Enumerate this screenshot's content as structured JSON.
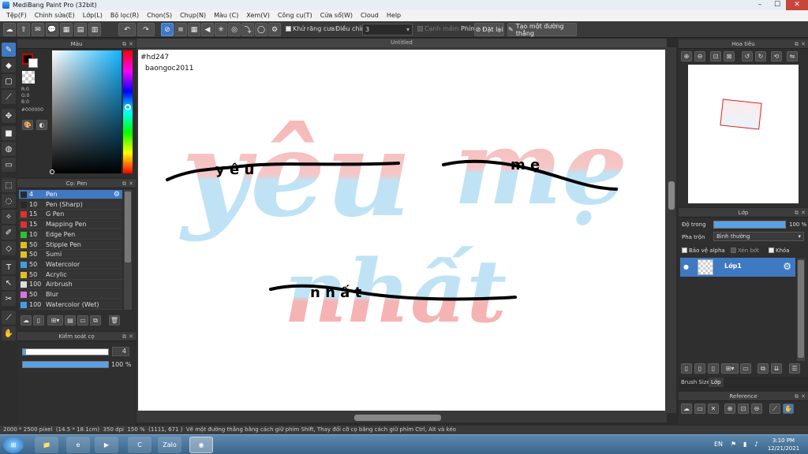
{
  "window": {
    "title": "MediBang Paint Pro (32bit)",
    "min": "–",
    "max": "☐",
    "close": "✕"
  },
  "menu": [
    "Tệp(F)",
    "Chỉnh sửa(E)",
    "Lớp(L)",
    "Bộ lọc(R)",
    "Chọn(S)",
    "Chụp(N)",
    "Màu (C)",
    "Xem(V)",
    "Công cụ(T)",
    "Cửa sổ(W)",
    "Cloud",
    "Help"
  ],
  "toolbar": {
    "antialias_label": "Khử răng cưa",
    "adjust_label": "Điều chỉnh",
    "adjust_value": "3",
    "edge_label": "Cạnh mềm",
    "pen_label": "Phím",
    "reset_label": "Đặt lại",
    "line_label": "Tạo một đường thẳng"
  },
  "color_panel": {
    "title": "Màu",
    "r": "R:0",
    "g": "G:0",
    "b": "B:0",
    "hex": "#000000",
    "fg": "#000000",
    "bg": "#ffffff"
  },
  "brush_panel": {
    "title": "Cọ: Pen",
    "items": [
      {
        "size": "4",
        "name": "Pen",
        "color": "#2a2a2a",
        "selected": true
      },
      {
        "size": "10",
        "name": "Pen (Sharp)",
        "color": "#2a2a2a",
        "selected": false
      },
      {
        "size": "15",
        "name": "G Pen",
        "color": "#e03030",
        "selected": false
      },
      {
        "size": "15",
        "name": "Mapping Pen",
        "color": "#e03030",
        "selected": false
      },
      {
        "size": "10",
        "name": "Edge Pen",
        "color": "#30c030",
        "selected": false
      },
      {
        "size": "50",
        "name": "Stipple Pen",
        "color": "#e0c020",
        "selected": false
      },
      {
        "size": "50",
        "name": "Sumi",
        "color": "#e0c020",
        "selected": false
      },
      {
        "size": "50",
        "name": "Watercolor",
        "color": "#40a0e0",
        "selected": false
      },
      {
        "size": "50",
        "name": "Acrylic",
        "color": "#e0c020",
        "selected": false
      },
      {
        "size": "100",
        "name": "Airbrush",
        "color": "#dddddd",
        "selected": false
      },
      {
        "size": "50",
        "name": "Blur",
        "color": "#e070e0",
        "selected": false
      },
      {
        "size": "100",
        "name": "Watercolor (Wet)",
        "color": "#40a0e0",
        "selected": false
      }
    ]
  },
  "brush_control": {
    "title": "Kiểm soát cọ",
    "size_value": "4",
    "opacity_value": "100 %",
    "size_fraction": 0.04,
    "opacity_fraction": 1.0
  },
  "canvas": {
    "tab": "Untitled",
    "watermark_line1": "#hd247",
    "watermark_line2": "baongoc2011",
    "big_text_1": "yêu",
    "big_text_2": "mẹ",
    "big_text_3": "nhất",
    "small_text_1": "y  ê  u",
    "small_text_2": "m  ẹ",
    "small_text_3": "n  h  ấ  t"
  },
  "navigator": {
    "title": "Hoa tiêu"
  },
  "layer_panel": {
    "title": "Lớp",
    "opacity_label": "Độ trong",
    "opacity_value": "100 %",
    "opacity_fraction": 1.0,
    "blend_label": "Pha trộn",
    "blend_value": "Bình thường",
    "protect_label": "Bảo vệ alpha",
    "clip_label": "Xén bớt",
    "lock_label": "Khóa",
    "layer_name": "Lớp1"
  },
  "bottom_tabs": {
    "brush_size": "Brush Size",
    "layer": "Lớp"
  },
  "reference_panel": {
    "title": "Reference"
  },
  "status": {
    "dimensions": "2000 * 2500 pixel",
    "physical": "(14.5 * 18.1cm)",
    "dpi": "350 dpi",
    "zoom": "150 %",
    "coords": "(1111, 671 )",
    "hint": "Vẽ một đường thẳng bằng cách giữ phím Shift, Thay đổi cỡ cọ bằng cách giữ phím Ctrl, Alt và kéo"
  },
  "taskbar": {
    "lang": "EN",
    "time": "3:10 PM",
    "date": "12/21/2021",
    "zalo": "Zalo"
  },
  "colors": {
    "accent": "#3f79c2",
    "pink": "#f6b3b3",
    "blue": "#bfe3f5"
  }
}
